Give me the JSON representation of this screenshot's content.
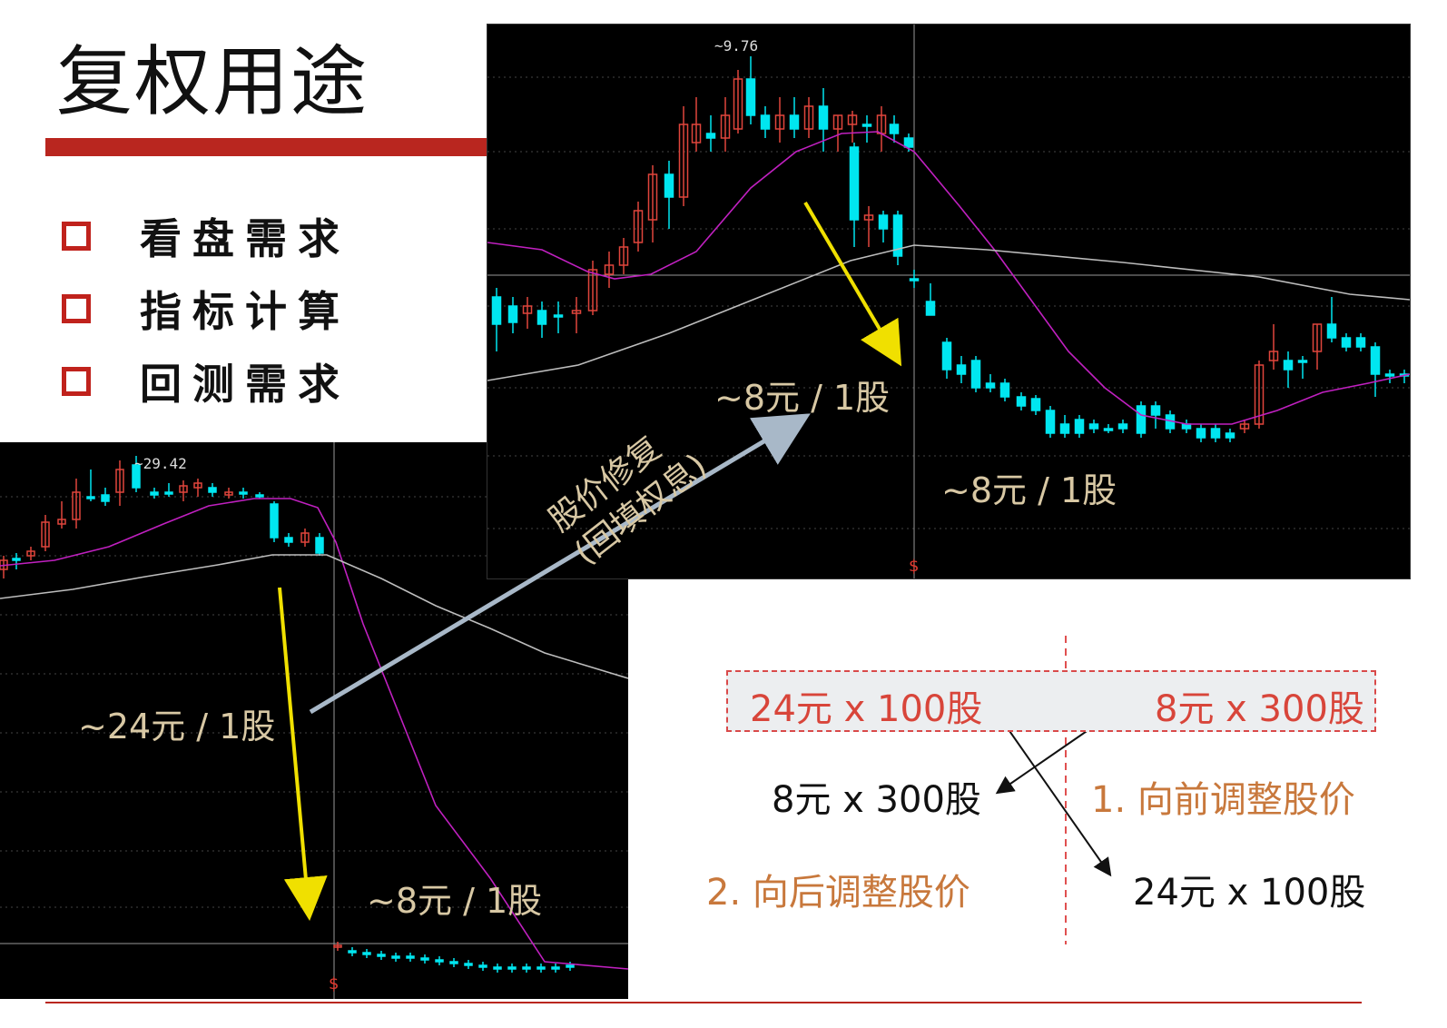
{
  "slide": {
    "title": "复权用途",
    "bullets": [
      "看盘需求",
      "指标计算",
      "回测需求"
    ]
  },
  "chart_top": {
    "peak_label": "9.76",
    "label_before": "~8元 / 1股",
    "label_after": "~8元 / 1股",
    "marker": "$",
    "arrow_note_line1": "股价修复",
    "arrow_note_line2": "(回填权息)"
  },
  "chart_bottom": {
    "peak_label": "29.42",
    "label_before": "~24元 / 1股",
    "label_after": "~8元 / 1股",
    "marker": "$"
  },
  "adjustment": {
    "top_left": "24元 x 100股",
    "top_right": "8元 x 300股",
    "forward_result": "8元 x 300股",
    "forward_label": "1. 向前调整股价",
    "backward_label": "2. 向后调整股价",
    "backward_result": "24元 x 100股"
  },
  "colors": {
    "accent": "#b9261f",
    "candle_up": "#e0453c",
    "candle_down": "#00e6f0",
    "ma_short": "#c020c0",
    "ma_long": "#bdbdbd",
    "arrow_yellow": "#f0e000",
    "arrow_gray": "#a8b8c8"
  }
}
